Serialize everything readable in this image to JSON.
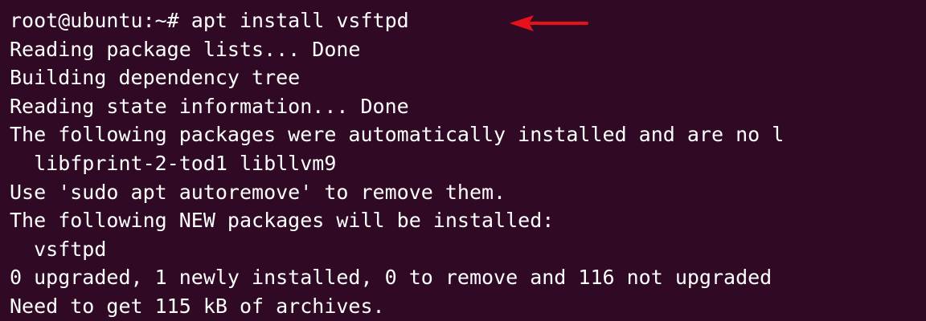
{
  "terminal": {
    "background": "#300a24",
    "foreground": "#ffffff",
    "lines": [
      "root@ubuntu:~# apt install vsftpd",
      "Reading package lists... Done",
      "Building dependency tree",
      "Reading state information... Done",
      "The following packages were automatically installed and are no l",
      "  libfprint-2-tod1 libllvm9",
      "Use 'sudo apt autoremove' to remove them.",
      "The following NEW packages will be installed:",
      "  vsftpd",
      "0 upgraded, 1 newly installed, 0 to remove and 116 not upgraded",
      "Need to get 115 kB of archives."
    ]
  },
  "annotation": {
    "icon": "red-left-arrow-icon",
    "color": "#e8101b"
  }
}
